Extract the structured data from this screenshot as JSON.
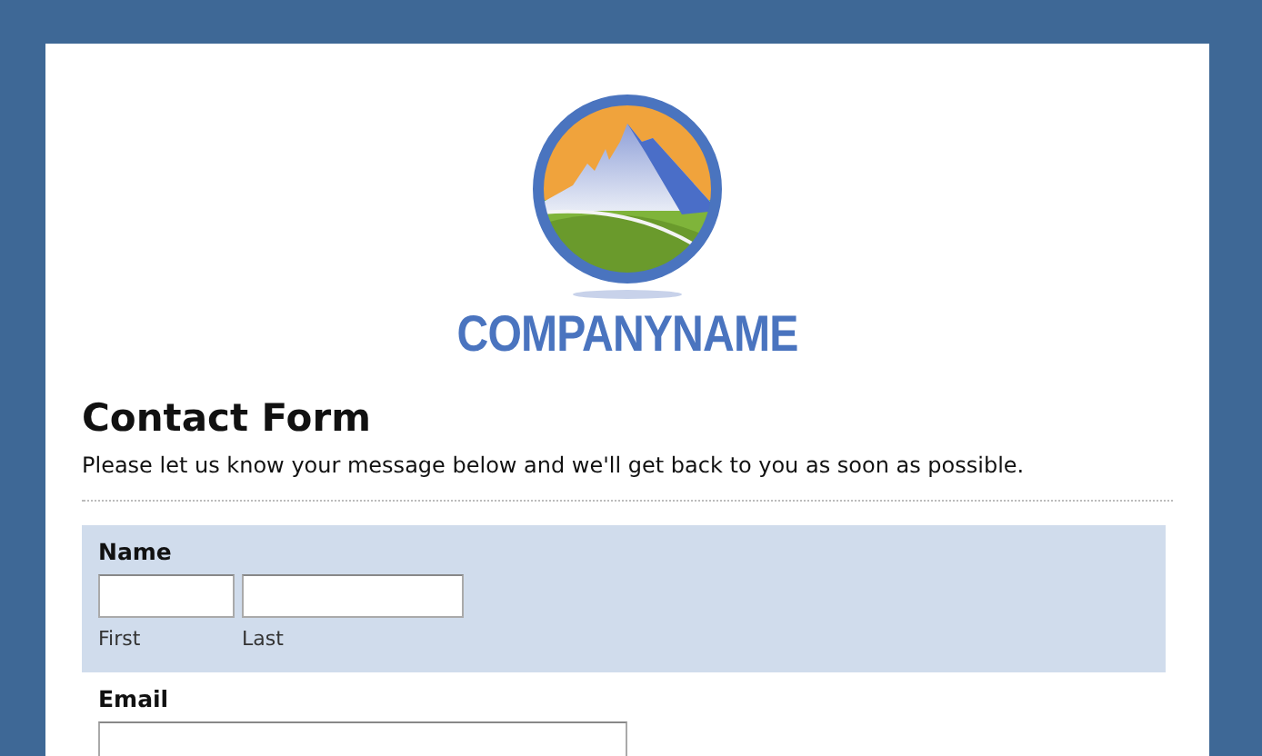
{
  "logo": {
    "company_name": "COMPANYNAME"
  },
  "form": {
    "title": "Contact Form",
    "description": "Please let us know your message below and we'll get back to you as soon as possible.",
    "fields": [
      {
        "kind": "name",
        "label": "Name",
        "highlighted": true,
        "inputs": [
          {
            "sublabel": "First"
          },
          {
            "sublabel": "Last"
          }
        ]
      },
      {
        "kind": "email",
        "label": "Email",
        "highlighted": false
      }
    ]
  }
}
